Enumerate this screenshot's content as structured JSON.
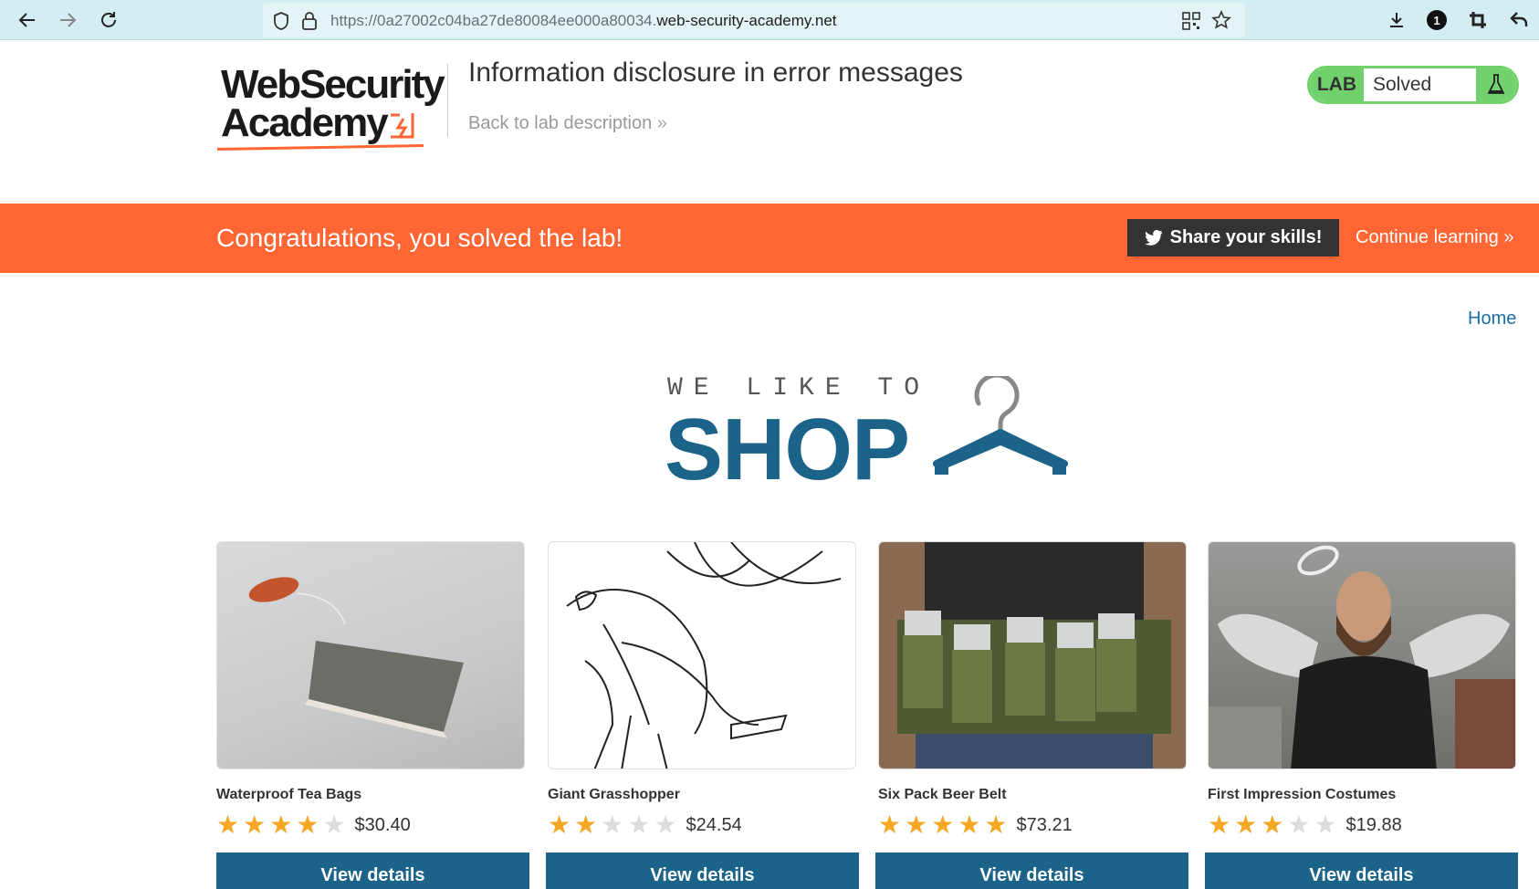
{
  "browser": {
    "url_prefix": "https://0a27002c04ba27de80084ee000a80034.",
    "url_domain": "web-security-academy.net",
    "notification_count": "1"
  },
  "header": {
    "logo_line1": "WebSecurity",
    "logo_line2": "Academy",
    "lab_title": "Information disclosure in error messages",
    "back_link": "Back to lab description",
    "badge_label": "LAB",
    "badge_status": "Solved"
  },
  "banner": {
    "message": "Congratulations, you solved the lab!",
    "share_label": "Share your skills!",
    "continue_label": "Continue learning"
  },
  "nav": {
    "home": "Home"
  },
  "shop": {
    "tagline": "WE LIKE TO",
    "word": "SHOP"
  },
  "products": [
    {
      "name": "Waterproof Tea Bags",
      "rating": 4,
      "price": "$30.40",
      "button": "View details"
    },
    {
      "name": "Giant Grasshopper",
      "rating": 2,
      "price": "$24.54",
      "button": "View details"
    },
    {
      "name": "Six Pack Beer Belt",
      "rating": 5,
      "price": "$73.21",
      "button": "View details"
    },
    {
      "name": "First Impression Costumes",
      "rating": 3,
      "price": "$19.88",
      "button": "View details"
    }
  ],
  "colors": {
    "accent_orange": "#ff6633",
    "lab_green": "#70d16d",
    "shop_blue": "#1b6389",
    "star": "#f5a623"
  }
}
